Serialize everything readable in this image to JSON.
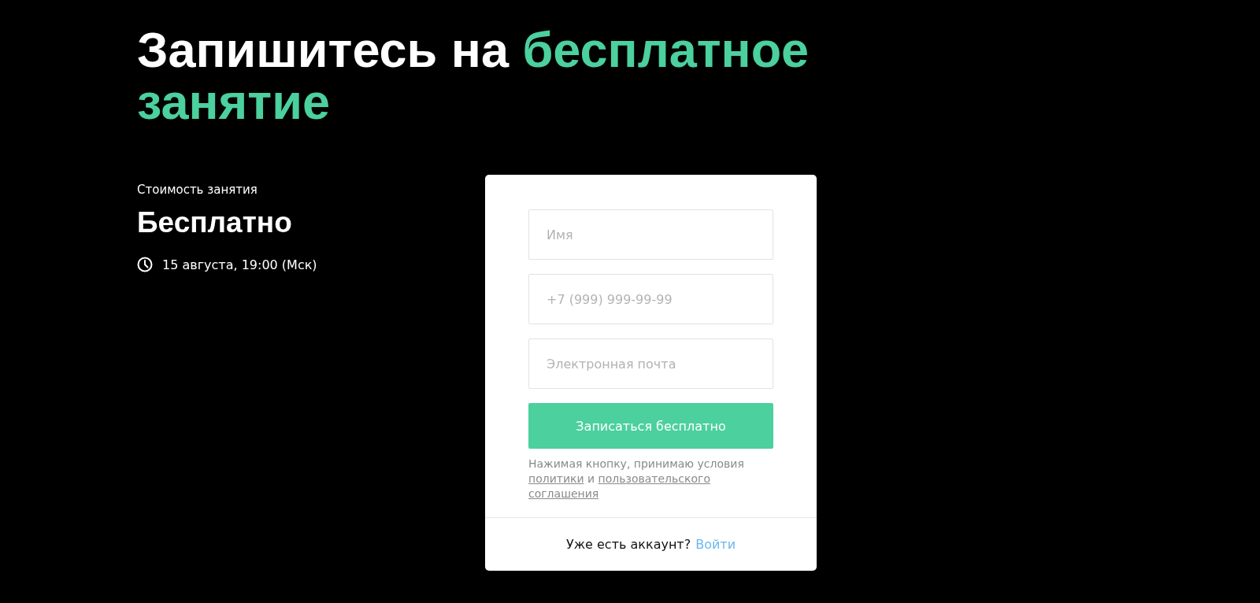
{
  "heading": {
    "plain": "Запишитесь на",
    "accent": "бесплатное занятие"
  },
  "price": {
    "label": "Стоимость занятия",
    "value": "Бесплатно"
  },
  "schedule": {
    "text": "15 августа, 19:00 (Мск)"
  },
  "form": {
    "fields": [
      {
        "placeholder": "Имя"
      },
      {
        "placeholder": "+7 (999) 999-99-99"
      },
      {
        "placeholder": "Электронная почта"
      }
    ],
    "submit": "Записаться бесплатно",
    "legal": {
      "text": "Нажимая кнопку, принимаю условия",
      "policy_link": "политики",
      "conjunction": "и",
      "agreement_link": [
        "пользовательского",
        "соглашения"
      ]
    },
    "footer": {
      "text": "Уже есть аккаунт?",
      "link": "Войти"
    }
  }
}
